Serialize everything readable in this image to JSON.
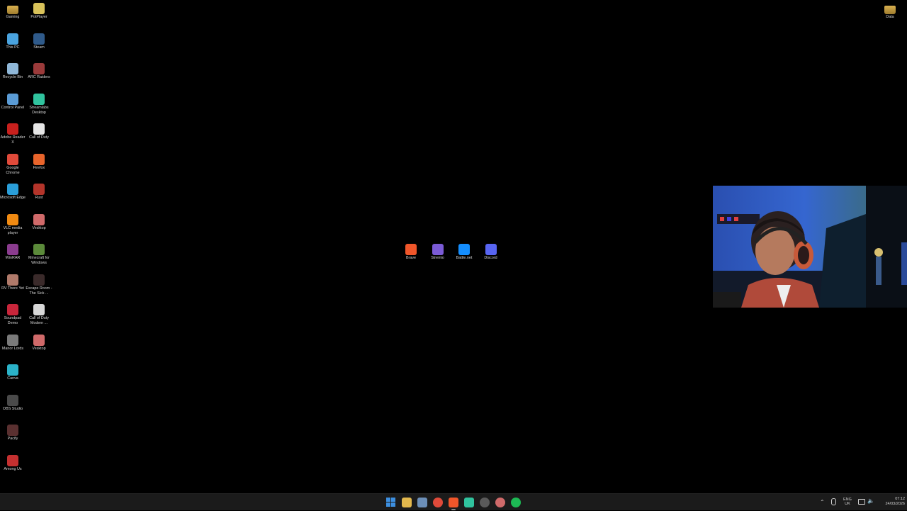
{
  "desktop": {
    "icons_left_col1": [
      {
        "label": "Gaming",
        "icon": "folder-icon",
        "color": "#d9b04f"
      },
      {
        "label": "This PC",
        "icon": "computer-icon",
        "color": "#4aa3df"
      },
      {
        "label": "Recycle Bin",
        "icon": "recycle-bin-icon",
        "color": "#8fb7d8"
      },
      {
        "label": "Control Panel",
        "icon": "control-panel-icon",
        "color": "#5a9bd5"
      },
      {
        "label": "Adobe Reader X",
        "icon": "adobe-reader-icon",
        "color": "#c8201d"
      },
      {
        "label": "Google Chrome",
        "icon": "chrome-icon",
        "color": "#e04a3a"
      },
      {
        "label": "Microsoft Edge",
        "icon": "edge-icon",
        "color": "#2a9ed9"
      },
      {
        "label": "VLC media player",
        "icon": "vlc-icon",
        "color": "#f08a12"
      },
      {
        "label": "WinRAR",
        "icon": "winrar-icon",
        "color": "#8b3c8f"
      },
      {
        "label": "RV There Yet",
        "icon": "game-icon",
        "color": "#b07a6a"
      },
      {
        "label": "Soundpad Demo",
        "icon": "soundpad-icon",
        "color": "#c9263b"
      },
      {
        "label": "Manor Lords",
        "icon": "game-icon",
        "color": "#7a7a7a"
      },
      {
        "label": "Canva",
        "icon": "canva-icon",
        "color": "#2bb3c9"
      },
      {
        "label": "OBS Studio",
        "icon": "obs-icon",
        "color": "#4a4a4a"
      },
      {
        "label": "Pacify",
        "icon": "game-icon",
        "color": "#5a3030"
      },
      {
        "label": "Among Us",
        "icon": "among-us-icon",
        "color": "#c43030"
      }
    ],
    "icons_left_col2": [
      {
        "label": "PotPlayer",
        "icon": "potplayer-icon",
        "color": "#d8c25a"
      },
      {
        "label": "Steam",
        "icon": "steam-icon",
        "color": "#2f5a8a"
      },
      {
        "label": "ARC Raiders",
        "icon": "game-icon",
        "color": "#9a3a3a"
      },
      {
        "label": "Streamlabs Desktop",
        "icon": "streamlabs-icon",
        "color": "#30c39e"
      },
      {
        "label": "Call of Duty",
        "icon": "file-icon",
        "color": "#e6e6e6"
      },
      {
        "label": "Firefox",
        "icon": "firefox-icon",
        "color": "#e8642b"
      },
      {
        "label": "Rust",
        "icon": "rust-icon",
        "color": "#b3342a"
      },
      {
        "label": "Vesktop",
        "icon": "vesktop-icon",
        "color": "#d06a6a"
      },
      {
        "label": "Minecraft for Windows",
        "icon": "minecraft-icon",
        "color": "#5b8a3a"
      },
      {
        "label": "Escape Room - The Sick ...",
        "icon": "game-icon",
        "color": "#3a2a2a"
      },
      {
        "label": "Call of Duty Modern ...",
        "icon": "game-icon",
        "color": "#d8d8d8"
      },
      {
        "label": "Vesktop",
        "icon": "vesktop-icon",
        "color": "#d06a6a"
      }
    ],
    "icons_center": [
      {
        "label": "Brave",
        "icon": "brave-icon",
        "color": "#f0562a"
      },
      {
        "label": "Stremio",
        "icon": "stremio-icon",
        "color": "#7b5bd6"
      },
      {
        "label": "Battle.net",
        "icon": "battlenet-icon",
        "color": "#148eff"
      },
      {
        "label": "Discord",
        "icon": "discord-icon",
        "color": "#5865f2"
      }
    ],
    "icons_right": [
      {
        "label": "Data",
        "icon": "folder-icon",
        "color": "#d9b04f"
      }
    ]
  },
  "taskbar": {
    "apps": [
      {
        "name": "start-button",
        "icon": "windows-icon",
        "color": "#3d8fe0"
      },
      {
        "name": "file-explorer",
        "icon": "folder-icon",
        "color": "#e3b84d"
      },
      {
        "name": "microsoft-store",
        "icon": "store-icon",
        "color": "#6c8fb8"
      },
      {
        "name": "chrome",
        "icon": "chrome-icon",
        "color": "#e04a3a"
      },
      {
        "name": "brave",
        "icon": "brave-icon",
        "color": "#f0562a"
      },
      {
        "name": "streamlabs",
        "icon": "streamlabs-icon",
        "color": "#30c39e"
      },
      {
        "name": "obs",
        "icon": "obs-icon",
        "color": "#5a5a5a"
      },
      {
        "name": "vesktop",
        "icon": "vesktop-icon",
        "color": "#d06a6a"
      },
      {
        "name": "spotify",
        "icon": "spotify-icon",
        "color": "#1db954"
      }
    ],
    "tray": {
      "language_top": "ENG",
      "language_bottom": "UK",
      "time": "07:12",
      "date": "24/03/2026"
    }
  }
}
